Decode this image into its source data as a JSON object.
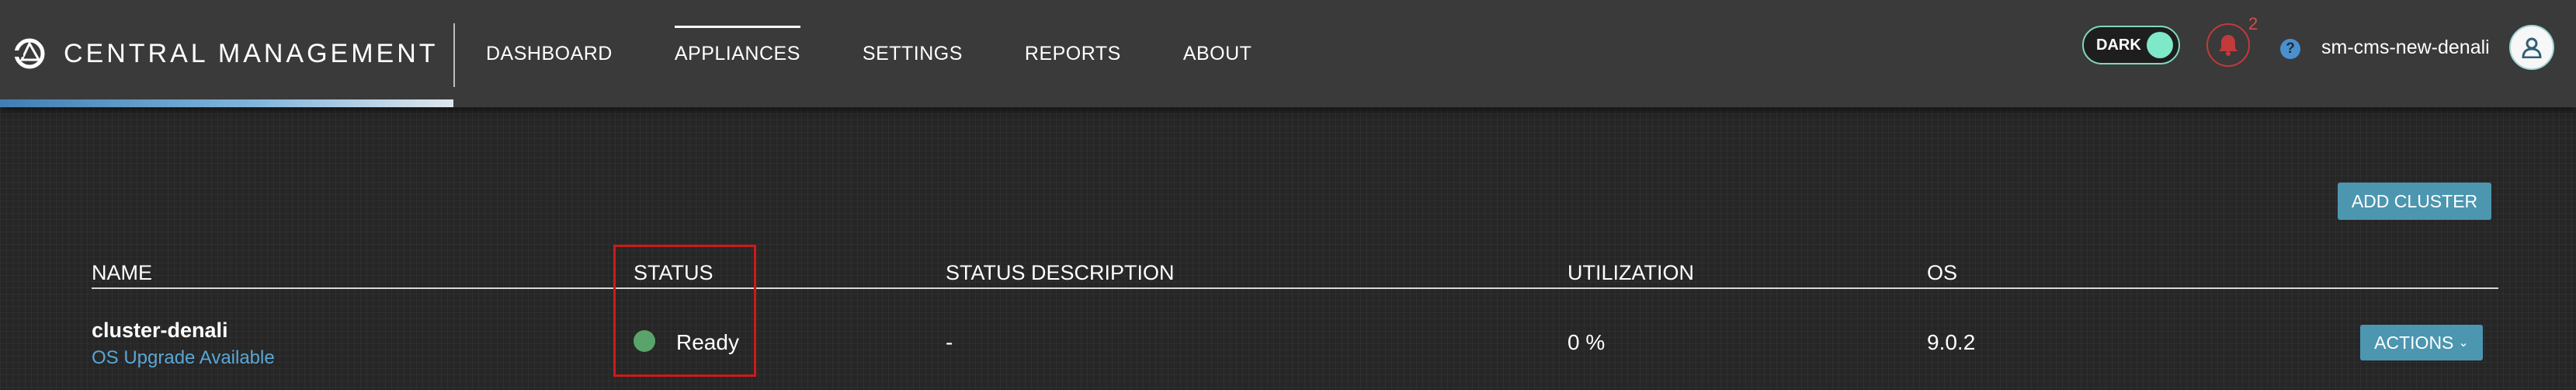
{
  "header": {
    "brand": "CENTRAL MANAGEMENT",
    "nav": [
      {
        "label": "DASHBOARD",
        "active": false
      },
      {
        "label": "APPLIANCES",
        "active": true
      },
      {
        "label": "SETTINGS",
        "active": false
      },
      {
        "label": "REPORTS",
        "active": false
      },
      {
        "label": "ABOUT",
        "active": false
      }
    ],
    "dark_toggle": {
      "label": "DARK",
      "on": true
    },
    "notifications": {
      "count": "2",
      "icon": "bell-icon"
    },
    "help": {
      "label": "?",
      "icon": "help-icon"
    },
    "user": {
      "name": "sm-cms-new-denali",
      "icon": "user-icon"
    }
  },
  "main": {
    "add_cluster_label": "ADD CLUSTER",
    "columns": [
      "NAME",
      "STATUS",
      "STATUS DESCRIPTION",
      "UTILIZATION",
      "OS"
    ],
    "rows": [
      {
        "name": "cluster-denali",
        "sub_link": "OS Upgrade Available",
        "status": "Ready",
        "status_description": "-",
        "utilization": "0 %",
        "os": "9.0.2",
        "actions_label": "ACTIONS"
      }
    ]
  },
  "colors": {
    "accent": "#4c96b0",
    "status_ready": "#5aa36a",
    "notification": "#c23a3a",
    "toggle": "#7fe8c9",
    "highlight": "#d01919"
  }
}
